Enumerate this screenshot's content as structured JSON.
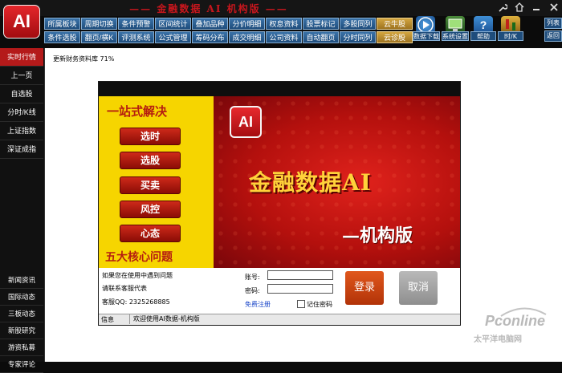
{
  "titlebar": {
    "title": "—— 金融数据 AI  机构版 ——"
  },
  "logo": "AI",
  "menu": {
    "row1": [
      "所属板块",
      "周期切换",
      "条件预警",
      "区间统计",
      "叠加品种",
      "分价明细",
      "权息资料",
      "股票标记",
      "多股同列",
      "云牛股"
    ],
    "row2": [
      "条件选股",
      "翻页/横K",
      "评测系统",
      "公式管理",
      "筹码分布",
      "成交明细",
      "公司资料",
      "自动翻页",
      "分时同列",
      "云诊股"
    ]
  },
  "toolbar": {
    "labels": [
      "数据下载",
      "系统设置",
      "帮助",
      "时/K"
    ]
  },
  "right_buttons": {
    "list": "列表",
    "back": "返回"
  },
  "sidebar": {
    "top": [
      "实时行情",
      "上一页",
      "自选股",
      "分时/K线",
      "上证指数",
      "深证成指"
    ],
    "bottom": [
      "新闻资讯",
      "国际动态",
      "三板动态",
      "新股研究",
      "游资私募",
      "专家评论"
    ]
  },
  "main": {
    "status": "更新财务资料库 71%"
  },
  "dialog": {
    "yellow_title": "一站式解决",
    "yellow_buttons": [
      "选时",
      "选股",
      "买卖",
      "风控",
      "心态"
    ],
    "yellow_footer": "五大核心问题",
    "badge": "AI",
    "brand": "金融数据AI",
    "edition": "—机构版"
  },
  "login": {
    "help_line1": "如果您在使用中遇到问题",
    "help_line2": "请联系客服代表",
    "qq": "客服QQ: 2325268885",
    "account_label": "账号:",
    "password_label": "密码:",
    "register_link": "免费注册",
    "remember_label": "记住密码",
    "login_button": "登录",
    "cancel_button": "取消",
    "info_label": "信息",
    "info_message": "欢迎使用AI数据-机构版"
  },
  "watermark": {
    "main": "Pconline",
    "sub": "太平洋电脑网"
  },
  "colors": {
    "brand_red": "#c8161d",
    "menu_blue": "#1f4d7c",
    "banner_yellow": "#f6d500"
  }
}
